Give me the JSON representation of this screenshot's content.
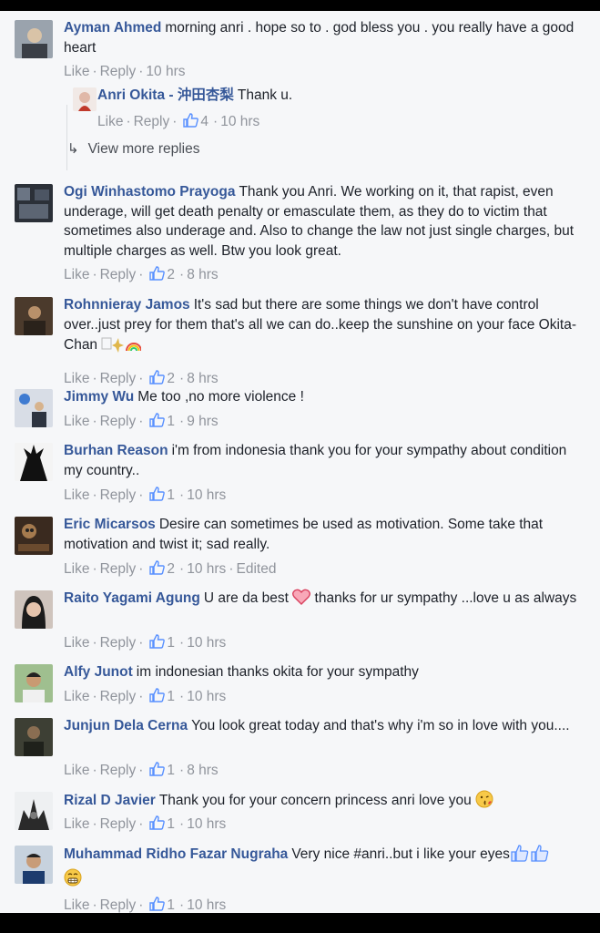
{
  "colors": {
    "link": "#365899",
    "meta": "#90949c",
    "background": "#f6f7f9"
  },
  "labels": {
    "like": "Like",
    "reply": "Reply"
  },
  "view_more_replies": "View more replies",
  "comments": [
    {
      "author": "Ayman Ahmed",
      "text": "morning anri . hope so to . god bless you . you really have a good heart",
      "likes": "",
      "time": "10 hrs",
      "edited": ""
    },
    {
      "author": "Ogi Winhastomo Prayoga",
      "text": "Thank you Anri. We working on it, that rapist, even underage, will get death penalty or emasculate them, as they do to victim that sometimes also underage and. Also to change the law not just single charges, but multiple charges as well. Btw you look great.",
      "likes": "2",
      "time": "8 hrs",
      "edited": ""
    },
    {
      "author": "Rohnnieray Jamos",
      "text": "It's sad but there are some things we don't have control over..just prey for them that's all we can do..keep the sunshine on your face Okita-Chan",
      "likes": "2",
      "time": "8 hrs",
      "edited": ""
    },
    {
      "author": "Jimmy Wu",
      "text": "Me too ,no more violence !",
      "likes": "1",
      "time": "9 hrs",
      "edited": ""
    },
    {
      "author": "Burhan Reason",
      "text": "i'm from indonesia thank you for your sympathy about condition my country..",
      "likes": "1",
      "time": "10 hrs",
      "edited": ""
    },
    {
      "author": "Eric Micarsos",
      "text": "Desire can sometimes be used as motivation. Some take that motivation and twist it; sad really.",
      "likes": "2",
      "time": "10 hrs",
      "edited": "Edited"
    },
    {
      "author": "Raito Yagami Agung",
      "text_before": "U are da best",
      "text_after": "thanks for ur sympathy ...love u as always",
      "likes": "1",
      "time": "10 hrs",
      "edited": ""
    },
    {
      "author": "Alfy Junot",
      "text": "im indonesian thanks okita for your sympathy",
      "likes": "1",
      "time": "10 hrs",
      "edited": ""
    },
    {
      "author": "Junjun Dela Cerna",
      "text": "You look great today and that's why i'm so in love with you....",
      "likes": "1",
      "time": "8 hrs",
      "edited": ""
    },
    {
      "author": "Rizal D Javier",
      "text": "Thank you for your concern princess anri love you",
      "likes": "1",
      "time": "10 hrs",
      "edited": ""
    },
    {
      "author": "Muhammad Ridho Fazar Nugraha",
      "text": "Very nice #anri..but i like your eyes",
      "likes": "1",
      "time": "10 hrs",
      "edited": ""
    }
  ],
  "reply": {
    "author": "Anri Okita - 沖田杏梨",
    "text": "Thank u.",
    "likes": "4",
    "time": "10 hrs"
  }
}
